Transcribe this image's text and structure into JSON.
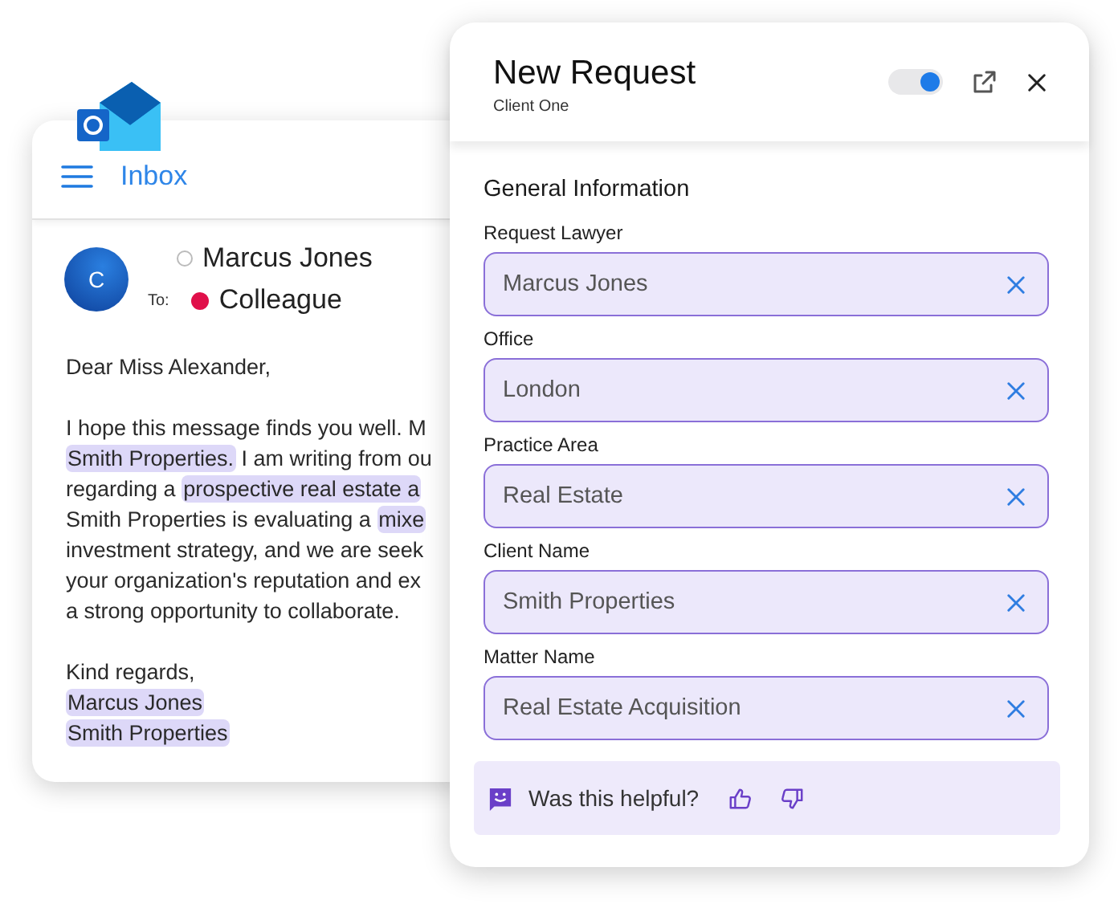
{
  "email": {
    "folder": "Inbox",
    "sender": {
      "initial": "C",
      "name": "Marcus Jones",
      "selected": false
    },
    "to_label": "To:",
    "recipient": {
      "name": "Colleague",
      "color": "#e0104a"
    },
    "greeting": "Dear Miss Alexander,",
    "body_lines": [
      [
        {
          "text": "I hope this message finds you well. M",
          "highlighted": false
        }
      ],
      [
        {
          "text": "Smith Properties.",
          "highlighted": true
        },
        {
          "text": " I am writing from ou",
          "highlighted": false
        }
      ],
      [
        {
          "text": "regarding a ",
          "highlighted": false
        },
        {
          "text": "prospective real estate a",
          "highlighted": true
        }
      ],
      [
        {
          "text": "Smith Properties is evaluating a ",
          "highlighted": false
        },
        {
          "text": "mixe",
          "highlighted": true
        }
      ],
      [
        {
          "text": "investment strategy, and we are seek",
          "highlighted": false
        }
      ],
      [
        {
          "text": "your organization's reputation and ex",
          "highlighted": false
        }
      ],
      [
        {
          "text": "a strong opportunity to collaborate.",
          "highlighted": false
        }
      ]
    ],
    "closing": "Kind regards,",
    "signature": [
      {
        "text": "Marcus Jones",
        "highlighted": true
      },
      {
        "text": "Smith Properties",
        "highlighted": true
      }
    ]
  },
  "panel": {
    "title": "New Request",
    "subtitle": "Client One",
    "toggle": {
      "on": true
    },
    "section": "General Information",
    "fields": [
      {
        "label": "Request Lawyer",
        "value": "Marcus Jones"
      },
      {
        "label": "Office",
        "value": "London"
      },
      {
        "label": "Practice Area",
        "value": "Real Estate"
      },
      {
        "label": "Client Name",
        "value": "Smith Properties"
      },
      {
        "label": "Matter Name",
        "value": "Real Estate Acquisition"
      }
    ],
    "feedback": {
      "question": "Was this helpful?"
    }
  }
}
